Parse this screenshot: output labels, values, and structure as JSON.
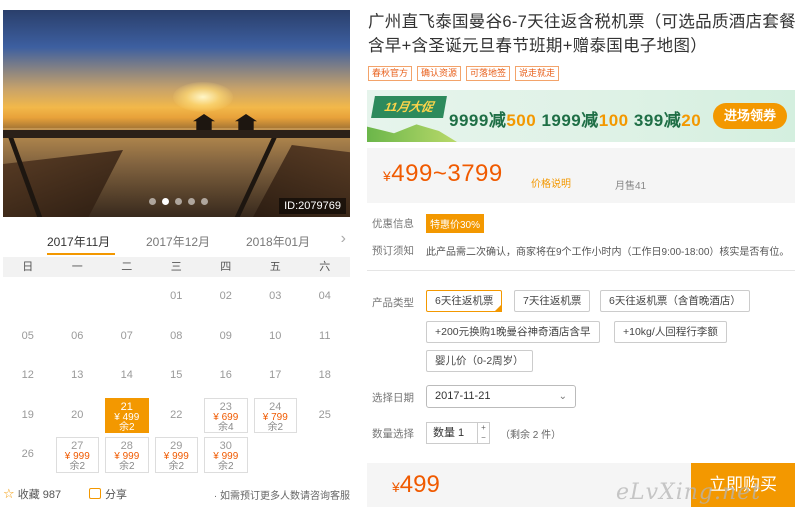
{
  "photo": {
    "id_label": "ID:2079769",
    "slide_count": 5,
    "active_slide": 1
  },
  "calendar": {
    "months": [
      "2017年11月",
      "2017年12月",
      "2018年01月"
    ],
    "active_month": 0,
    "next_icon": "chevron-right-icon",
    "weekdays": [
      "日",
      "一",
      "二",
      "三",
      "四",
      "五",
      "六"
    ],
    "cells": [
      {
        "day": ""
      },
      {
        "day": ""
      },
      {
        "day": ""
      },
      {
        "day": "01"
      },
      {
        "day": "02"
      },
      {
        "day": "03"
      },
      {
        "day": "04"
      },
      {
        "day": "05"
      },
      {
        "day": "06"
      },
      {
        "day": "07"
      },
      {
        "day": "08"
      },
      {
        "day": "09"
      },
      {
        "day": "10"
      },
      {
        "day": "11"
      },
      {
        "day": "12"
      },
      {
        "day": "13"
      },
      {
        "day": "14"
      },
      {
        "day": "15"
      },
      {
        "day": "16"
      },
      {
        "day": "17"
      },
      {
        "day": "18"
      },
      {
        "day": "19"
      },
      {
        "day": "20"
      },
      {
        "day": "21",
        "price": "¥ 499",
        "remain": "余2",
        "selected": true
      },
      {
        "day": "22"
      },
      {
        "day": "23",
        "price": "¥ 699",
        "remain": "余4"
      },
      {
        "day": "24",
        "price": "¥ 799",
        "remain": "余2"
      },
      {
        "day": "25"
      },
      {
        "day": "26"
      },
      {
        "day": "27",
        "price": "¥ 999",
        "remain": "余2"
      },
      {
        "day": "28",
        "price": "¥ 999",
        "remain": "余2"
      },
      {
        "day": "29",
        "price": "¥ 999",
        "remain": "余2"
      },
      {
        "day": "30",
        "price": "¥ 999",
        "remain": "余2"
      }
    ]
  },
  "footer": {
    "fav_label": "收藏 987",
    "share_label": "分享",
    "note": "· 如需预订更多人数请咨询客服"
  },
  "product": {
    "title": "广州直飞泰国曼谷6-7天往返含税机票（可选品质酒店套餐含早+含圣诞元旦春节班期+赠泰国电子地图）",
    "tags": [
      "春秋官方",
      "确认资源",
      "可落地签",
      "说走就走"
    ]
  },
  "banner": {
    "badge": "11月大促",
    "deals": [
      {
        "a": "9999减",
        "b": "500"
      },
      {
        "a": "1999减",
        "b": "100"
      },
      {
        "a": "399减",
        "b": "20"
      }
    ],
    "cta": "进场领券"
  },
  "price": {
    "currency": "¥",
    "range": "499~3799",
    "explain": "价格说明",
    "sold": "月售41"
  },
  "promo": {
    "label": "优惠信息",
    "badge": "特惠价30%"
  },
  "notice": {
    "label": "预订须知",
    "text": "此产品需二次确认，商家将在9个工作小时内（工作日9:00-18:00）核实是否有位。"
  },
  "options": {
    "label": "产品类型",
    "items": [
      {
        "text": "6天往返机票",
        "selected": true
      },
      {
        "text": "7天往返机票"
      },
      {
        "text": "6天往返机票（含首晚酒店）"
      },
      {
        "text": "+200元换购1晚曼谷神奇酒店含早"
      },
      {
        "text": "+10kg/人回程行李额"
      },
      {
        "text": "婴儿价（0-2周岁）"
      }
    ]
  },
  "date": {
    "label": "选择日期",
    "value": "2017-11-21"
  },
  "quantity": {
    "label": "数量选择",
    "value": "数量  1",
    "remain": "（剩余 2 件）"
  },
  "buy": {
    "currency": "¥",
    "total": "499",
    "button": "立即购买"
  },
  "watermark": "eLvXing.net",
  "colors": {
    "accent": "#f39800",
    "price": "#f05a00",
    "banner_green": "#1f6f46"
  }
}
